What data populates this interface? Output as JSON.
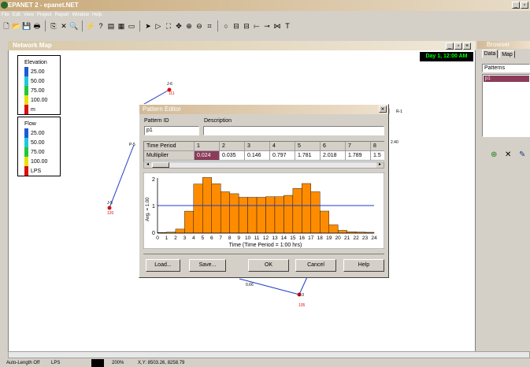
{
  "app": {
    "title": "EPANET 2 - epanet.NET"
  },
  "menu": [
    "File",
    "Edit",
    "View",
    "Project",
    "Report",
    "Window",
    "Help"
  ],
  "network_window": {
    "title": "Network Map",
    "time": "Day 1, 12:00 AM"
  },
  "legend_elevation": {
    "title": "Elevation",
    "entries": [
      {
        "label": "25.00",
        "color": "#1e5bd4"
      },
      {
        "label": "50.00",
        "color": "#22c8d8"
      },
      {
        "label": "75.00",
        "color": "#22c83c"
      },
      {
        "label": "100.00",
        "color": "#e8e010"
      },
      {
        "label": "m",
        "color": "#d81010"
      }
    ]
  },
  "legend_flow": {
    "title": "Flow",
    "entries": [
      {
        "label": "25.00",
        "color": "#1e5bd4"
      },
      {
        "label": "50.00",
        "color": "#22c8d8"
      },
      {
        "label": "75.00",
        "color": "#22c83c"
      },
      {
        "label": "100.00",
        "color": "#e8e010"
      },
      {
        "label": "LPS",
        "color": "#d81010"
      }
    ]
  },
  "nodes": {
    "j6": {
      "id": "J-6",
      "value": "111"
    },
    "p5": {
      "id": "P-5"
    },
    "j5": {
      "id": "J-5",
      "value": "120"
    },
    "r1": {
      "id": "R-1",
      "value": "2.40"
    },
    "j3": {
      "id": "J-3",
      "value": "105"
    },
    "link_value": "0.66"
  },
  "dialog": {
    "title": "Pattern Editor",
    "pattern_id_label": "Pattern ID",
    "pattern_id_value": "p1",
    "description_label": "Description",
    "description_value": "",
    "grid": {
      "row_header_1": "Time Period",
      "row_header_2": "Multiplier",
      "periods": [
        "1",
        "2",
        "3",
        "4",
        "5",
        "6",
        "7",
        "8"
      ],
      "multipliers": [
        "0.024",
        "0.035",
        "0.146",
        "0.797",
        "1.781",
        "2.018",
        "1.789",
        "1.5"
      ]
    },
    "buttons": {
      "load": "Load...",
      "save": "Save...",
      "ok": "OK",
      "cancel": "Cancel",
      "help": "Help"
    }
  },
  "chart_data": {
    "type": "bar",
    "xlabel": "Time (Time Period = 1:00 hrs)",
    "ylabel": "Avg. = 1.00",
    "ylim": [
      0,
      2
    ],
    "yticks": [
      "2",
      "1",
      "0"
    ],
    "average": 1.0,
    "bar_color": "#ff8c00",
    "avg_line_color": "#1e3cc8",
    "x_ticks": [
      "0",
      "1",
      "2",
      "3",
      "4",
      "5",
      "6",
      "7",
      "8",
      "9",
      "10",
      "11",
      "12",
      "13",
      "14",
      "15",
      "16",
      "17",
      "18",
      "19",
      "20",
      "21",
      "22",
      "23",
      "24"
    ],
    "values": [
      0.024,
      0.035,
      0.146,
      0.797,
      1.781,
      2.018,
      1.789,
      1.5,
      1.43,
      1.3,
      1.3,
      1.3,
      1.32,
      1.32,
      1.37,
      1.62,
      1.8,
      1.5,
      0.8,
      0.3,
      0.1,
      0.05,
      0.04,
      0.03
    ]
  },
  "browser": {
    "title": "Browser",
    "tabs": [
      "Data",
      "Map"
    ],
    "dropdown": "Patterns",
    "list_items": [
      "p1"
    ]
  },
  "status": {
    "autolength": "Auto-Length Off",
    "units": "LPS",
    "zoom": "200%",
    "xy": "X,Y: 8503.26, 8258.79"
  }
}
